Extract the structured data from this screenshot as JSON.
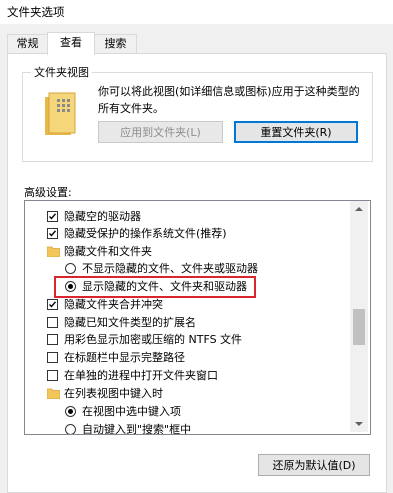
{
  "window": {
    "title": "文件夹选项"
  },
  "tabs": [
    {
      "label": "常规",
      "active": false
    },
    {
      "label": "查看",
      "active": true
    },
    {
      "label": "搜索",
      "active": false
    }
  ],
  "folder_views": {
    "group_label": "文件夹视图",
    "description": "你可以将此视图(如详细信息或图标)应用于这种类型的所有文件夹。",
    "apply_button": "应用到文件夹(L)",
    "reset_button": "重置文件夹(R)"
  },
  "advanced": {
    "label": "高级设置:",
    "items": [
      {
        "type": "checkbox",
        "label": "隐藏空的驱动器",
        "checked": true
      },
      {
        "type": "checkbox",
        "label": "隐藏受保护的操作系统文件(推荐)",
        "checked": true
      },
      {
        "type": "folder",
        "label": "隐藏文件和文件夹"
      },
      {
        "type": "radio",
        "label": "不显示隐藏的文件、文件夹或驱动器",
        "checked": false
      },
      {
        "type": "radio",
        "label": "显示隐藏的文件、文件夹和驱动器",
        "checked": true,
        "highlighted": true
      },
      {
        "type": "checkbox",
        "label": "隐藏文件夹合并冲突",
        "checked": true
      },
      {
        "type": "checkbox",
        "label": "隐藏已知文件类型的扩展名",
        "checked": false
      },
      {
        "type": "checkbox",
        "label": "用彩色显示加密或压缩的 NTFS 文件",
        "checked": false
      },
      {
        "type": "checkbox",
        "label": "在标题栏中显示完整路径",
        "checked": false
      },
      {
        "type": "checkbox",
        "label": "在单独的进程中打开文件夹窗口",
        "checked": false
      },
      {
        "type": "folder",
        "label": "在列表视图中键入时"
      },
      {
        "type": "radio",
        "label": "在视图中选中键入项",
        "checked": true
      },
      {
        "type": "radio",
        "label": "自动键入到\"搜索\"框中",
        "checked": false
      }
    ]
  },
  "restore_button": "还原为默认值(D)",
  "colors": {
    "highlight": "#d9262c",
    "accent": "#0078d7",
    "folder": "#f3c659"
  }
}
